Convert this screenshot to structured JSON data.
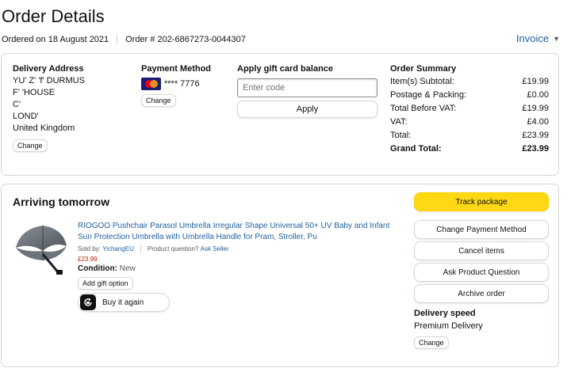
{
  "header": {
    "title": "Order Details",
    "ordered_on": "Ordered on 18 August 2021",
    "order_number": "Order # 202-6867273-0044307",
    "invoice_label": "Invoice"
  },
  "delivery_address": {
    "heading": "Delivery Address",
    "lines": [
      "YU' Z' 'f' DURMUS",
      "F' 'HOUSE",
      "C'",
      "LOND'",
      "United Kingdom"
    ],
    "change_label": "Change"
  },
  "payment": {
    "heading": "Payment Method",
    "card_icon": "mastercard-icon",
    "card_digits": "**** 7776",
    "change_label": "Change"
  },
  "gift_card": {
    "heading": "Apply gift card balance",
    "placeholder": "Enter code",
    "apply_label": "Apply"
  },
  "order_summary": {
    "heading": "Order Summary",
    "rows": [
      {
        "label": "Item(s) Subtotal:",
        "value": "£19.99"
      },
      {
        "label": "Postage & Packing:",
        "value": "£0.00"
      },
      {
        "label": "Total Before VAT:",
        "value": "£19.99"
      },
      {
        "label": "VAT:",
        "value": "£4.00"
      },
      {
        "label": "Total:",
        "value": "£23.99"
      }
    ],
    "grand_total_label": "Grand Total:",
    "grand_total_value": "£23.99"
  },
  "shipment": {
    "status": "Arriving tomorrow",
    "product_title": "RIOGOO Pushchair Parasol Umbrella Irregular Shape Universal 50+ UV Baby and Infant Sun Protection Umbrella with Umbrella Handle for Pram, Stroller, Pu",
    "sold_by_label": "Sold by:",
    "seller": "YichangEU",
    "product_question_label": "Product question?",
    "ask_seller": "Ask Seller",
    "price": "£23.99",
    "condition_label": "Condition:",
    "condition_value": "New",
    "add_gift_label": "Add gift option",
    "buy_again_label": "Buy it again",
    "buy_again_icon": "buy-again-icon"
  },
  "actions": {
    "track": "Track package",
    "change_payment": "Change Payment Method",
    "cancel": "Cancel items",
    "ask_question": "Ask Product Question",
    "archive": "Archive order"
  },
  "delivery_speed": {
    "heading": "Delivery speed",
    "value": "Premium Delivery",
    "change_label": "Change"
  },
  "colors": {
    "link": "#2162a1",
    "price": "#b12704",
    "primary_button": "#ffd814",
    "border": "#d5d9d9"
  }
}
